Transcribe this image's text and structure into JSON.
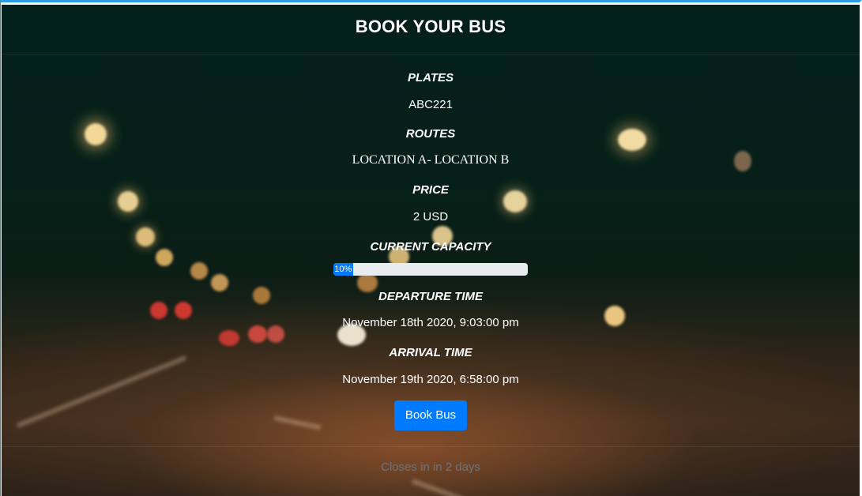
{
  "card": {
    "title": "BOOK YOUR BUS",
    "plates_label": "PLATES",
    "plates_value": "ABC221",
    "routes_label": "ROUTES",
    "routes_value": "LOCATION A- LOCATION B",
    "price_label": "PRICE",
    "price_value": "2 USD",
    "capacity_label": "CURRENT CAPACITY",
    "capacity_percent": 10,
    "capacity_text": "10%",
    "departure_label": "DEPARTURE TIME",
    "departure_value": "November 18th 2020, 9:03:00 pm",
    "arrival_label": "ARRIVAL TIME",
    "arrival_value": "November 19th 2020, 6:58:00 pm",
    "book_button_label": "Book Bus",
    "footer_text": "Closes in in 2 days"
  },
  "colors": {
    "accent": "#007bff",
    "window_border": "#2a9fe8",
    "progress_track": "#e9ecef",
    "footer_text": "#6c757d"
  }
}
